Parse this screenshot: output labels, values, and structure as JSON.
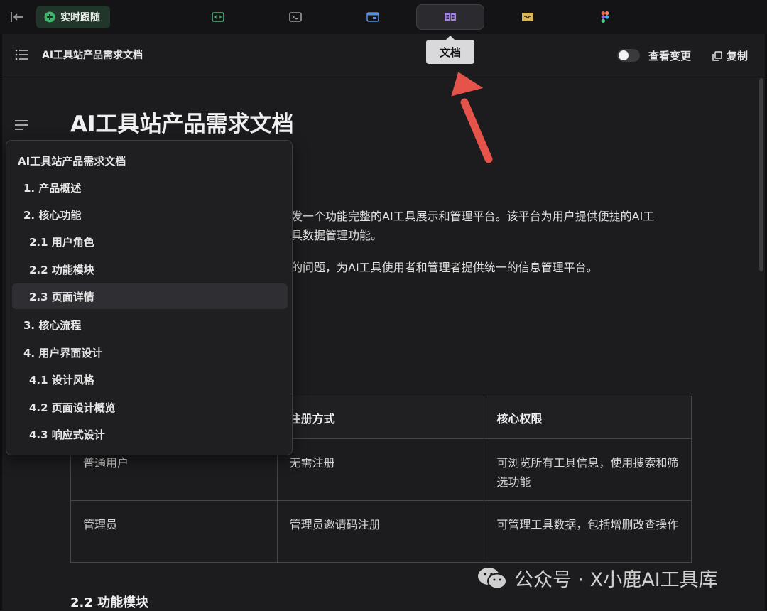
{
  "toolbar": {
    "follow_label": "实时跟随",
    "tabs": [
      {
        "icon": "code-icon",
        "color": "#4fb07a"
      },
      {
        "icon": "terminal-icon",
        "color": "#9a9a9a"
      },
      {
        "icon": "preview-window-icon",
        "color": "#5b8fd6"
      },
      {
        "icon": "document-icon",
        "color": "#a285e0",
        "active": true
      },
      {
        "icon": "inbox-icon",
        "color": "#d7b35a"
      },
      {
        "icon": "figma-icon",
        "color": "#e36b4b"
      }
    ]
  },
  "tooltip": {
    "label": "文档"
  },
  "doc_header": {
    "title": "AI工具站产品需求文档",
    "toggle_label": "查看变更",
    "copy_label": "复制"
  },
  "content": {
    "title": "AI工具站产品需求文档",
    "para1_line1": "发一个功能完整的AI工具展示和管理平台。该平台为用户提供便捷的AI工",
    "para1_line2": "具数据管理功能。",
    "para2": "的问题，为AI工具使用者和管理者提供统一的信息管理平台。",
    "section_heading": "2.2 功能模块"
  },
  "roles_table": {
    "headers": [
      "",
      "注册方式",
      "核心权限"
    ],
    "rows": [
      [
        "普通用户",
        "无需注册",
        "可浏览所有工具信息，使用搜索和筛选功能"
      ],
      [
        "管理员",
        "管理员邀请码注册",
        "可管理工具数据，包括增删改查操作"
      ]
    ]
  },
  "outline": {
    "items": [
      {
        "label": "AI工具站产品需求文档",
        "level": 0
      },
      {
        "label": "1. 产品概述",
        "level": 1
      },
      {
        "label": "2. 核心功能",
        "level": 1
      },
      {
        "label": "2.1 用户角色",
        "level": 2
      },
      {
        "label": "2.2 功能模块",
        "level": 2
      },
      {
        "label": "2.3 页面详情",
        "level": 2,
        "selected": true
      },
      {
        "label": "3. 核心流程",
        "level": 1
      },
      {
        "label": "4. 用户界面设计",
        "level": 1
      },
      {
        "label": "4.1 设计风格",
        "level": 2
      },
      {
        "label": "4.2 页面设计概览",
        "level": 2
      },
      {
        "label": "4.3 响应式设计",
        "level": 2
      }
    ]
  },
  "watermark": {
    "text": "公众号 · X小鹿AI工具库"
  },
  "colors": {
    "accent_arrow": "#e5534b",
    "background": "#1c1c1e"
  }
}
